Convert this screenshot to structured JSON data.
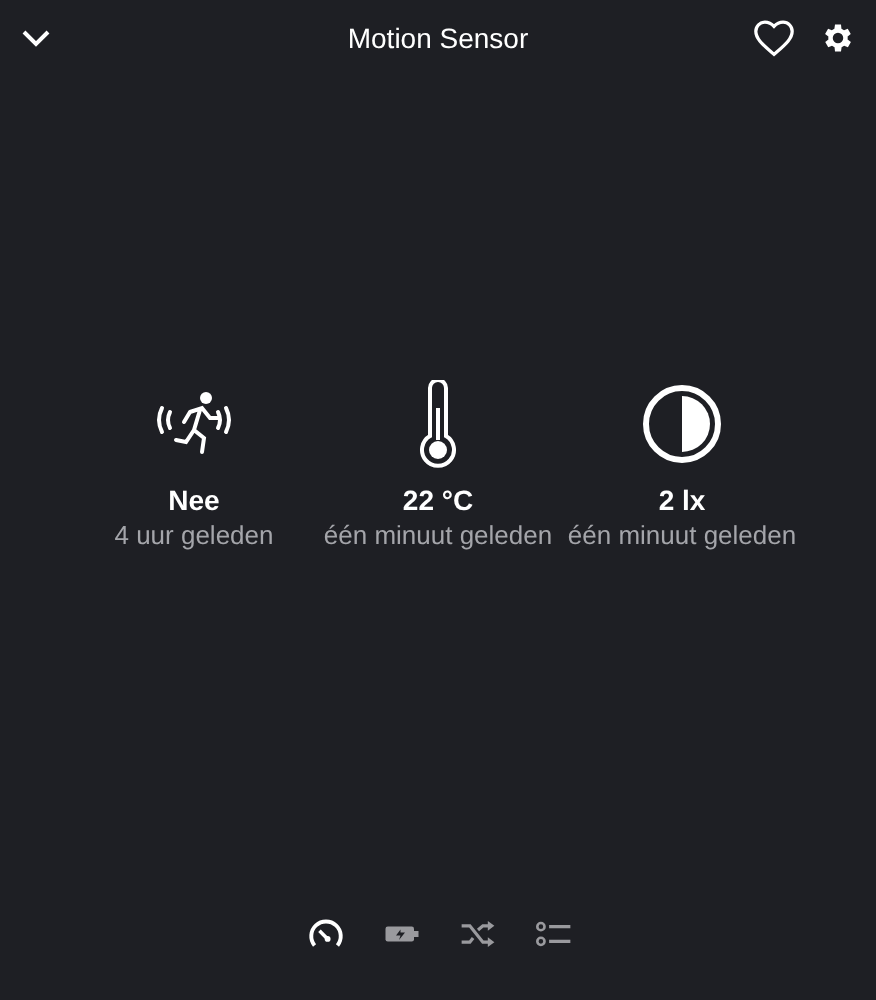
{
  "window": {
    "title": "Motion Sensor"
  },
  "sensors": [
    {
      "kind": "motion",
      "value": "Nee",
      "time": "4 uur geleden"
    },
    {
      "kind": "temperature",
      "value": "22 °C",
      "time": "één minuut geleden"
    },
    {
      "kind": "illuminance",
      "value": "2 lx",
      "time": "één minuut geleden"
    }
  ],
  "tabs": [
    {
      "kind": "gauge",
      "selected": true
    },
    {
      "kind": "battery",
      "selected": false
    },
    {
      "kind": "shuffle",
      "selected": false
    },
    {
      "kind": "list",
      "selected": false
    }
  ]
}
